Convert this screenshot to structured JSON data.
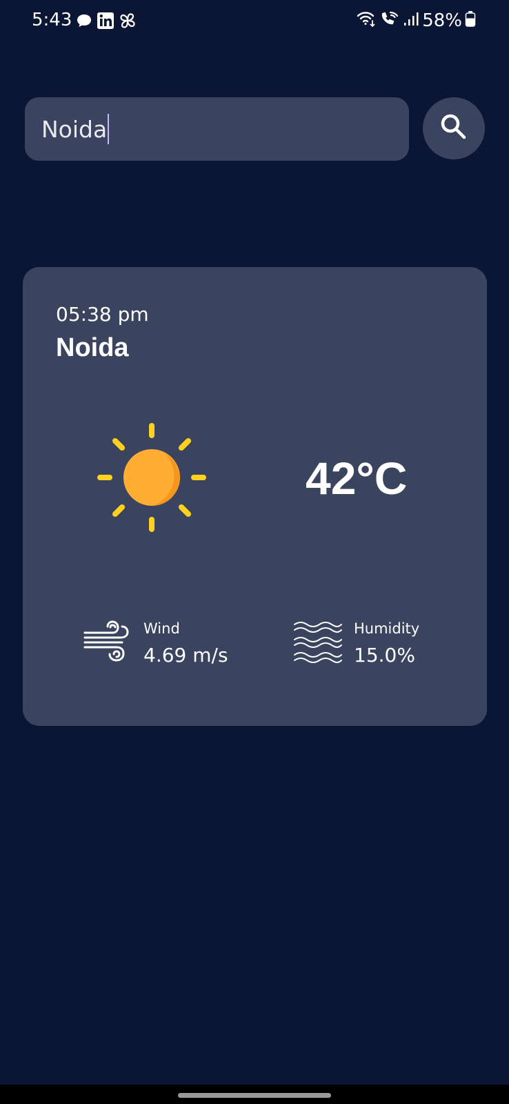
{
  "status_bar": {
    "time": "5:43",
    "battery": "58%",
    "left_icons": [
      "chat-bubble-icon",
      "linkedin-icon",
      "pinwheel-icon"
    ],
    "right_icons": [
      "wifi-icon",
      "wifi-calling-icon",
      "signal-icon",
      "battery-icon"
    ]
  },
  "search": {
    "value": "Noida"
  },
  "weather": {
    "local_time": "05:38 pm",
    "city": "Noida",
    "condition_icon": "sun-icon",
    "temperature": "42°C",
    "wind": {
      "label": "Wind",
      "value": "4.69 m/s"
    },
    "humidity": {
      "label": "Humidity",
      "value": "15.0%"
    }
  },
  "colors": {
    "background": "#0b1534",
    "card": "#3a445e",
    "sun": "#ffad33",
    "sun_rays": "#ffd21f"
  }
}
